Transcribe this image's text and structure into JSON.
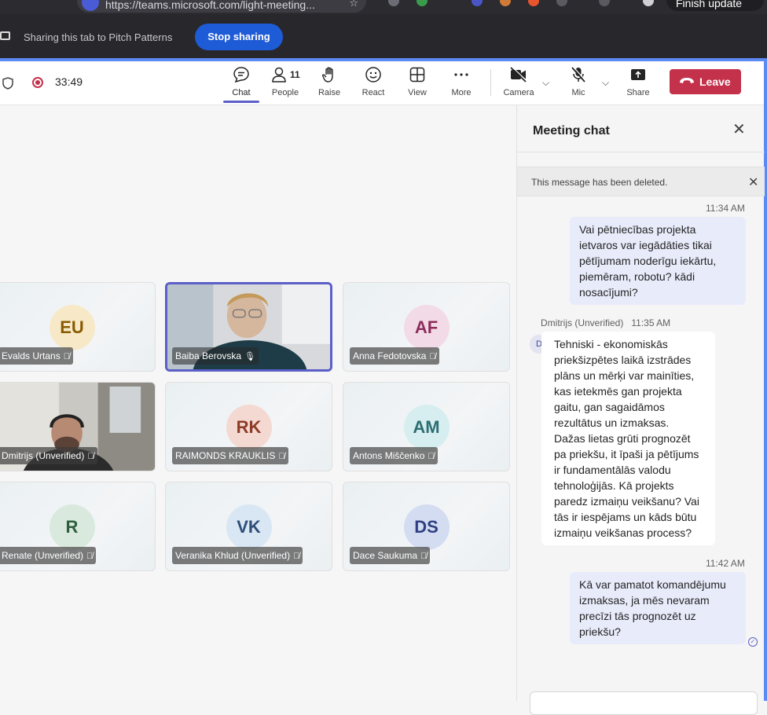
{
  "browser": {
    "url": "https://teams.microsoft.com/light-meeting...",
    "finish_update_label": "Finish update"
  },
  "share_bar": {
    "message": "Sharing this tab to Pitch Patterns",
    "stop_label": "Stop sharing"
  },
  "toolbar": {
    "timer": "33:49",
    "people_count": "11",
    "items": [
      {
        "label": "Chat",
        "icon": "chat-icon"
      },
      {
        "label": "People",
        "icon": "people-icon"
      },
      {
        "label": "Raise",
        "icon": "raise-hand-icon"
      },
      {
        "label": "React",
        "icon": "react-icon"
      },
      {
        "label": "View",
        "icon": "view-icon"
      },
      {
        "label": "More",
        "icon": "more-icon"
      },
      {
        "label": "Camera",
        "icon": "camera-off-icon"
      },
      {
        "label": "Mic",
        "icon": "mic-off-icon"
      },
      {
        "label": "Share",
        "icon": "share-icon"
      }
    ],
    "leave_label": "Leave"
  },
  "participants": [
    {
      "initials": "EU",
      "name": "Evalds Urtans",
      "color": "#f7e9c8",
      "text_color": "#8a5a00"
    },
    {
      "initials": "",
      "name": "Baiba Berovska",
      "video": true
    },
    {
      "initials": "AF",
      "name": "Anna Fedotovska",
      "color": "#f2dbe6",
      "text_color": "#8c2d5b"
    },
    {
      "initials": "",
      "name": "Dmitrijs (Unverified)",
      "video": true
    },
    {
      "initials": "RK",
      "name": "RAIMONDS KRAUKLIS",
      "color": "#f3d9d2",
      "text_color": "#8e3b27"
    },
    {
      "initials": "AM",
      "name": "Antons Miščenko",
      "color": "#d7eef0",
      "text_color": "#2c6e73"
    },
    {
      "initials": "R",
      "name": "Renate (Unverified)",
      "color": "#d9e9de",
      "text_color": "#2f5e3c"
    },
    {
      "initials": "VK",
      "name": "Veranika Khlud (Unverified)",
      "color": "#d9e6f3",
      "text_color": "#2d4e7a"
    },
    {
      "initials": "DS",
      "name": "Dace Saukuma",
      "color": "#d4dcf1",
      "text_color": "#2f3f82"
    }
  ],
  "chat": {
    "title": "Meeting chat",
    "deleted_notice": "This message has been deleted.",
    "messages": [
      {
        "time": "11:34 AM",
        "mine": true,
        "lines": [
          "Vai pētniecības projekta",
          "ietvaros var iegādāties tikai",
          "pētījumam noderīgu iekārtu,",
          "piemēram, robotu? kādi",
          "nosacījumi?"
        ]
      },
      {
        "sender": "Dmitrijs (Unverified)",
        "time": "11:35 AM",
        "avatar_initial": "D",
        "mine": false,
        "lines": [
          "Tehniski - ekonomiskās",
          "priekšizpētes laikā izstrādes",
          "plāns un mērķi var mainīties,",
          "kas ietekmēs gan projekta",
          "gaitu, gan sagaidāmos",
          "rezultātus un izmaksas.",
          "Dažas lietas grūti prognozēt",
          "pa priekšu, it īpaši ja pētījums",
          "ir fundamentālās valodu",
          "tehnoloģijās. Kā projekts",
          "paredz izmaiņu veikšanu? Vai",
          "tās ir iespējams un kāds būtu",
          "izmaiņu veikšanas process?"
        ]
      },
      {
        "time": "11:42 AM",
        "mine": true,
        "lines": [
          "Kā var pamatot komandējumu",
          "izmaksas, ja mēs nevaram",
          "precīzi tās prognozēt uz",
          "priekšu?"
        ]
      }
    ]
  }
}
